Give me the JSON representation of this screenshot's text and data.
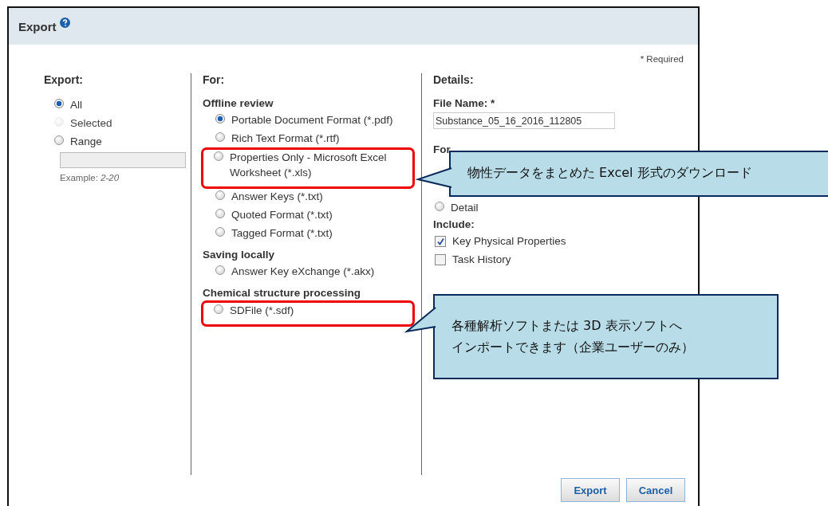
{
  "window": {
    "title": "Export"
  },
  "required_note": "* Required",
  "export": {
    "heading": "Export:",
    "options": [
      {
        "label": "All",
        "selected": true,
        "disabled": false
      },
      {
        "label": "Selected",
        "selected": false,
        "disabled": true
      },
      {
        "label": "Range",
        "selected": false,
        "disabled": false
      }
    ],
    "example_label": "Example:",
    "example_value": "2-20"
  },
  "for": {
    "heading": "For:",
    "groups": [
      {
        "title": "Offline review",
        "options": [
          {
            "label": "Portable Document Format (*.pdf)",
            "selected": true,
            "highlighted": false
          },
          {
            "label": "Rich Text Format (*.rtf)",
            "selected": false,
            "highlighted": false
          },
          {
            "label": "Properties Only - Microsoft Excel Worksheet (*.xls)",
            "selected": false,
            "highlighted": true
          },
          {
            "label": "Answer Keys (*.txt)",
            "selected": false,
            "highlighted": false
          },
          {
            "label": "Quoted Format (*.txt)",
            "selected": false,
            "highlighted": false
          },
          {
            "label": "Tagged Format (*.txt)",
            "selected": false,
            "highlighted": false
          }
        ]
      },
      {
        "title": "Saving locally",
        "options": [
          {
            "label": "Answer Key eXchange (*.akx)",
            "selected": false,
            "highlighted": false
          }
        ]
      },
      {
        "title": "Chemical structure processing",
        "options": [
          {
            "label": "SDFile (*.sdf)",
            "selected": false,
            "highlighted": true
          }
        ]
      }
    ]
  },
  "details": {
    "heading": "Details:",
    "file_name_label": "File Name: *",
    "file_name": "Substance_05_16_2016_112805",
    "format_heading": "For",
    "format_options": [
      {
        "label": "Detail",
        "selected": false
      }
    ],
    "include_heading": "Include:",
    "include": [
      {
        "label": "Key Physical Properties",
        "checked": true
      },
      {
        "label": "Task History",
        "checked": false
      }
    ]
  },
  "buttons": [
    {
      "label": "Export"
    },
    {
      "label": "Cancel"
    }
  ],
  "annotations": [
    {
      "lines": [
        "物性データをまとめた Excel 形式のダウンロード"
      ]
    },
    {
      "lines": [
        "各種解析ソフトまたは 3D 表示ソフトへ",
        "インポートできます（企業ユーザーのみ）"
      ]
    }
  ]
}
